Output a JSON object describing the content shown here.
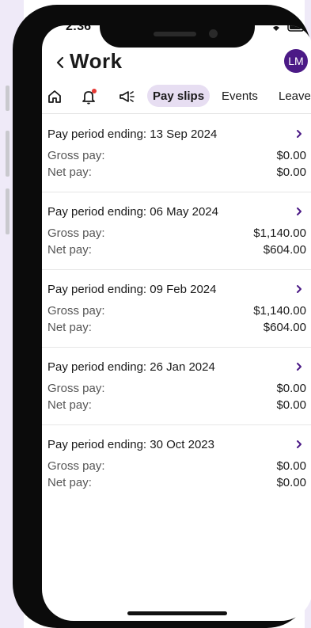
{
  "status_bar": {
    "time": "2:36"
  },
  "header": {
    "title": "Work",
    "avatar_initials": "LM"
  },
  "tabs": {
    "active_label": "Pay slips",
    "events_label": "Events",
    "leave_label": "Leave"
  },
  "payslips": [
    {
      "title": "Pay period ending: 13 Sep 2024",
      "gross_label": "Gross pay:",
      "gross": "$0.00",
      "net_label": "Net pay:",
      "net": "$0.00"
    },
    {
      "title": "Pay period ending: 06 May 2024",
      "gross_label": "Gross pay:",
      "gross": "$1,140.00",
      "net_label": "Net pay:",
      "net": "$604.00"
    },
    {
      "title": "Pay period ending: 09 Feb 2024",
      "gross_label": "Gross pay:",
      "gross": "$1,140.00",
      "net_label": "Net pay:",
      "net": "$604.00"
    },
    {
      "title": "Pay period ending: 26 Jan 2024",
      "gross_label": "Gross pay:",
      "gross": "$0.00",
      "net_label": "Net pay:",
      "net": "$0.00"
    },
    {
      "title": "Pay period ending: 30 Oct 2023",
      "gross_label": "Gross pay:",
      "gross": "$0.00",
      "net_label": "Net pay:",
      "net": "$0.00"
    }
  ],
  "colors": {
    "accent": "#4b1a86",
    "pill_bg": "#e7def2",
    "notification_dot": "#e53935"
  }
}
